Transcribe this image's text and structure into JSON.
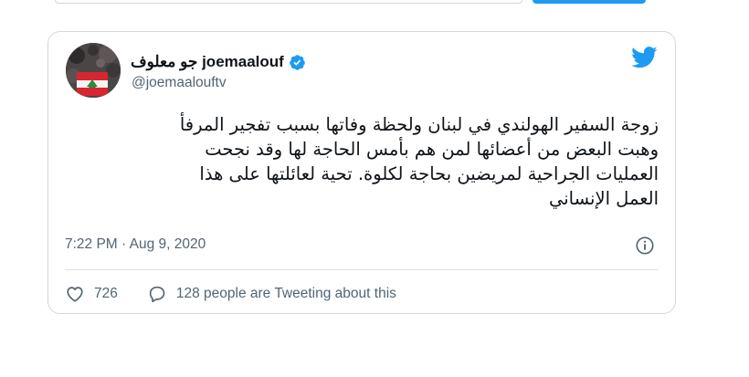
{
  "tweet": {
    "display_name": "جو معلوف joemaalouf",
    "handle": "@joemaalouftv",
    "text_lines": [
      "زوجة السفير الهولندي في لبنان ولحظة وفاتها بسبب تفجير المرفأ",
      "وهبت البعض من أعضائها لمن هم بأمس الحاجة لها وقد نجحت",
      "العمليات الجراحية لمريضين بحاجة لكلوة. تحية لعائلتها  على هذا",
      "العمل الإنساني"
    ],
    "timestamp": "7:22 PM · Aug 9, 2020",
    "like_count": "726",
    "reply_text": "128 people are Tweeting about this"
  },
  "colors": {
    "accent": "#1d9bf0",
    "secondary_text": "#536471",
    "border": "#cfd9de",
    "flag_red": "#d7262f",
    "flag_green": "#2a8b3f"
  },
  "icons": {
    "verified": "verified-badge-icon",
    "brand": "twitter-bird-icon",
    "info": "info-icon",
    "like": "heart-icon",
    "reply": "comment-bubble-icon"
  }
}
